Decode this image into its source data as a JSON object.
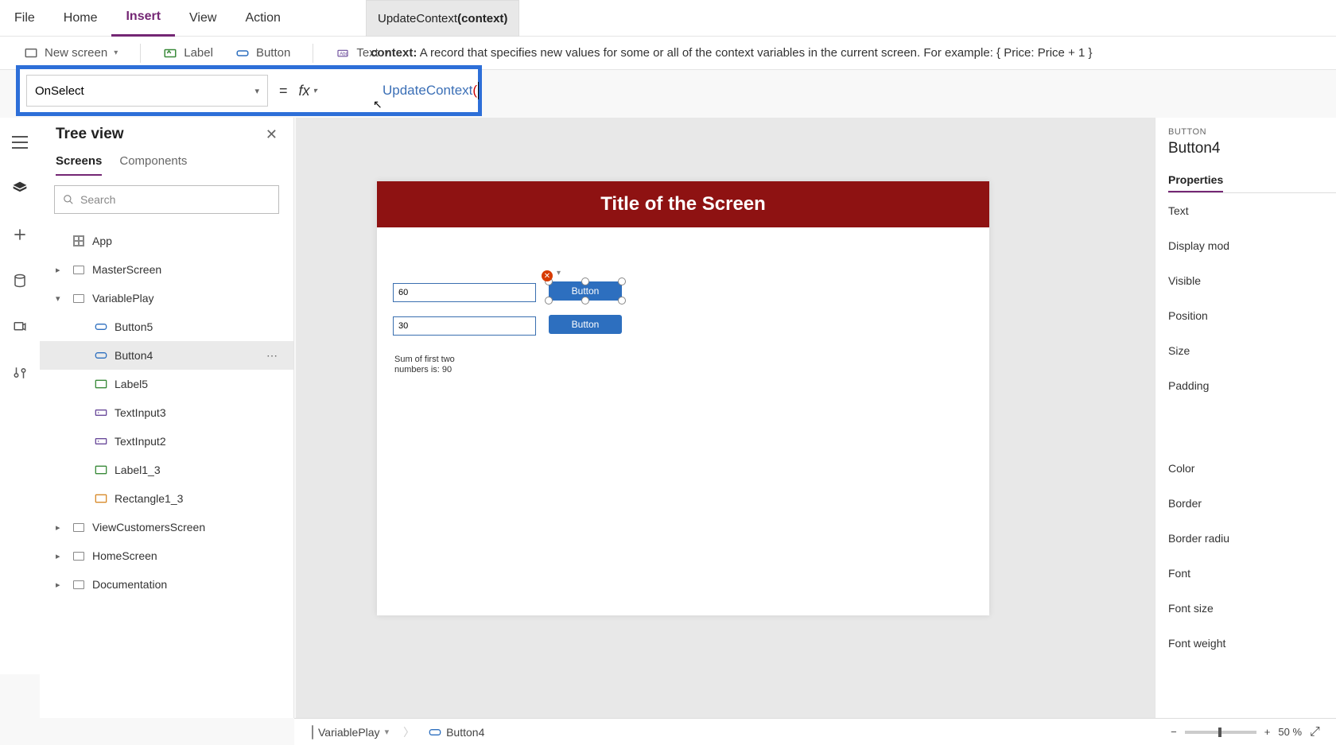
{
  "menu": {
    "file": "File",
    "home": "Home",
    "insert": "Insert",
    "view": "View",
    "action": "Action"
  },
  "intellisense": {
    "fn": "UpdateContext",
    "param": "context"
  },
  "ribbon": {
    "newscreen": "New screen",
    "label": "Label",
    "button": "Button",
    "text": "Text"
  },
  "hint": {
    "label": "context:",
    "desc": "A record that specifies new values for some or all of the context variables in the current screen. For example: { Price: Price + 1 }"
  },
  "formula": {
    "property": "OnSelect",
    "equals": "=",
    "fx": "fx",
    "fn": "UpdateContext",
    "paren": "("
  },
  "treeview": {
    "title": "Tree view",
    "tabs": {
      "screens": "Screens",
      "components": "Components"
    },
    "search_placeholder": "Search",
    "nodes": {
      "app": "App",
      "master": "MasterScreen",
      "varplay": "VariablePlay",
      "button5": "Button5",
      "button4": "Button4",
      "label5": "Label5",
      "textinput3": "TextInput3",
      "textinput2": "TextInput2",
      "label1_3": "Label1_3",
      "rectangle1_3": "Rectangle1_3",
      "viewcust": "ViewCustomersScreen",
      "homescreen": "HomeScreen",
      "documentation": "Documentation"
    }
  },
  "canvas": {
    "title": "Title of the Screen",
    "input1": "60",
    "input2": "30",
    "button1": "Button",
    "button2": "Button",
    "sumtext1": "Sum of first two",
    "sumtext2": "numbers is: 90"
  },
  "props": {
    "kind": "BUTTON",
    "name": "Button4",
    "tab": "Properties",
    "rows": {
      "text": "Text",
      "displaymode": "Display mod",
      "visible": "Visible",
      "position": "Position",
      "size": "Size",
      "padding": "Padding",
      "color": "Color",
      "border": "Border",
      "borderradius": "Border radiu",
      "font": "Font",
      "fontsize": "Font size",
      "fontweight": "Font weight"
    }
  },
  "status": {
    "screen": "VariablePlay",
    "control": "Button4"
  },
  "zoom": {
    "percent": "50",
    "unit": "%"
  }
}
